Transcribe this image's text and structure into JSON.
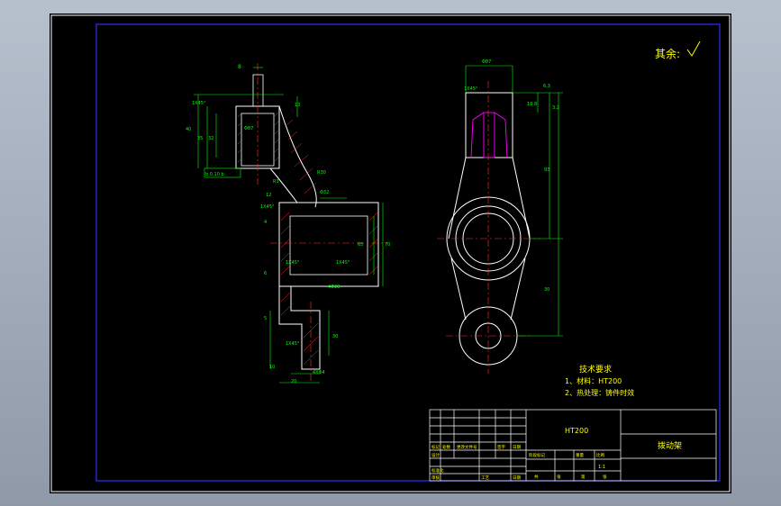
{
  "drawing": {
    "roughness_note": "其余:",
    "tech_req_title": "技术要求",
    "tech_req_items": [
      "1、材料：HT200",
      "2、热处理：铸件时效"
    ],
    "title_block": {
      "material": "HT200",
      "part_name": "拨动架",
      "scale": "1:1",
      "header_cells": [
        "标记",
        "处数",
        "更改文件号",
        "签字",
        "日期"
      ],
      "row_labels": [
        "设计",
        "标准化",
        "审核",
        "工艺",
        "日期"
      ],
      "stage_cells": [
        "阶段标记",
        "重量",
        "比例"
      ],
      "sheet_cells": [
        "共",
        "张",
        "第",
        "张"
      ]
    },
    "dimensions": {
      "top_slot_width": "8",
      "chamfer_1": "1X45°",
      "chamfer_2": "1X45°",
      "chamfer_3": "1X45°",
      "chamfer_4": "1X45°",
      "chamfer_5": "1X45°",
      "chamfer_6": "1X45°",
      "hole_dia": "Φ87",
      "height_40": "40",
      "height_35": "35",
      "height_32": "32",
      "height_13": "13",
      "tol_label": "b 0.10 b",
      "radius_r30": "R30",
      "r3": "R3",
      "depth_12": "12",
      "dia_32": "Φ32",
      "dim_4": "4",
      "dim_6": "6",
      "dim_10": "10",
      "dim_20": "20",
      "dim_70": "70",
      "dim_65": "65",
      "dim_30": "30",
      "dim_5": "5",
      "dim_93": "93",
      "dim_19": "19.8",
      "dim_6_3": "6.3",
      "dim_bottom": "4XΦ4",
      "dim_r28": "4Φ28",
      "dim_3_2": "3.2"
    }
  }
}
